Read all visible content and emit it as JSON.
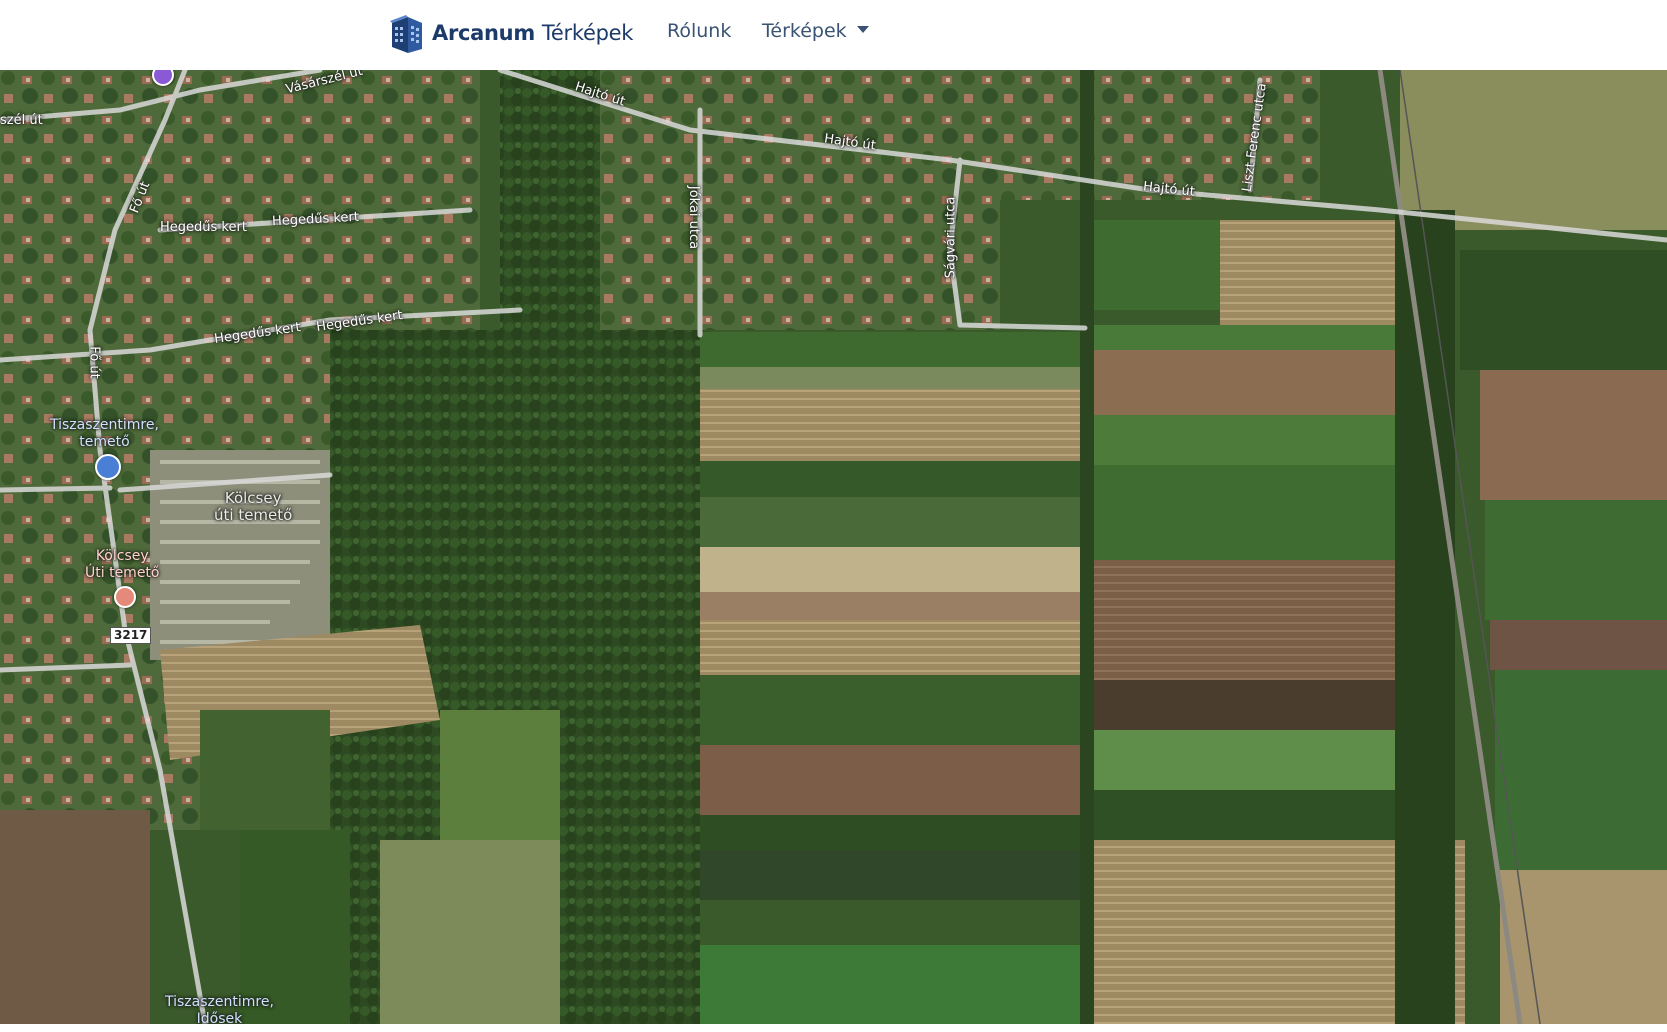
{
  "brand": {
    "name": "Arcanum",
    "subtitle": "Térképek"
  },
  "nav": {
    "about_label": "Rólunk",
    "maps_label": "Térképek"
  },
  "map": {
    "road_labels": {
      "vasarszel_1": "Vásárszél út",
      "vasarszel_2": "szél út",
      "hajto_1": "Hajtó út",
      "hajto_2": "Hajtó út",
      "hajto_3": "Hajtó út",
      "fo_1": "Fő út",
      "fo_2": "Fő út",
      "hegedus_1": "Hegedűs kert",
      "hegedus_2": "Hegedűs kert",
      "hegedus_3": "Hegedűs kert",
      "hegedus_4": "Hegedűs kert",
      "jokai": "Jókai utca",
      "sagvari": "Ságvári utca",
      "liszt": "Liszt Ferenc utca"
    },
    "poi": {
      "bus_stop_1": "Tiszaszentimre,\ntemető",
      "cemetery_area": "Kölcsey\núti temető",
      "cemetery_poi": "Kölcsey\nÚti temető",
      "bus_stop_2": "Tiszaszentimre,\nIdősek"
    },
    "route_shield": "3217",
    "colors": {
      "bus_stop": "#4a7fd6",
      "cemetery_pin": "#e58a7a",
      "service_pin": "#8a5ad6"
    }
  }
}
